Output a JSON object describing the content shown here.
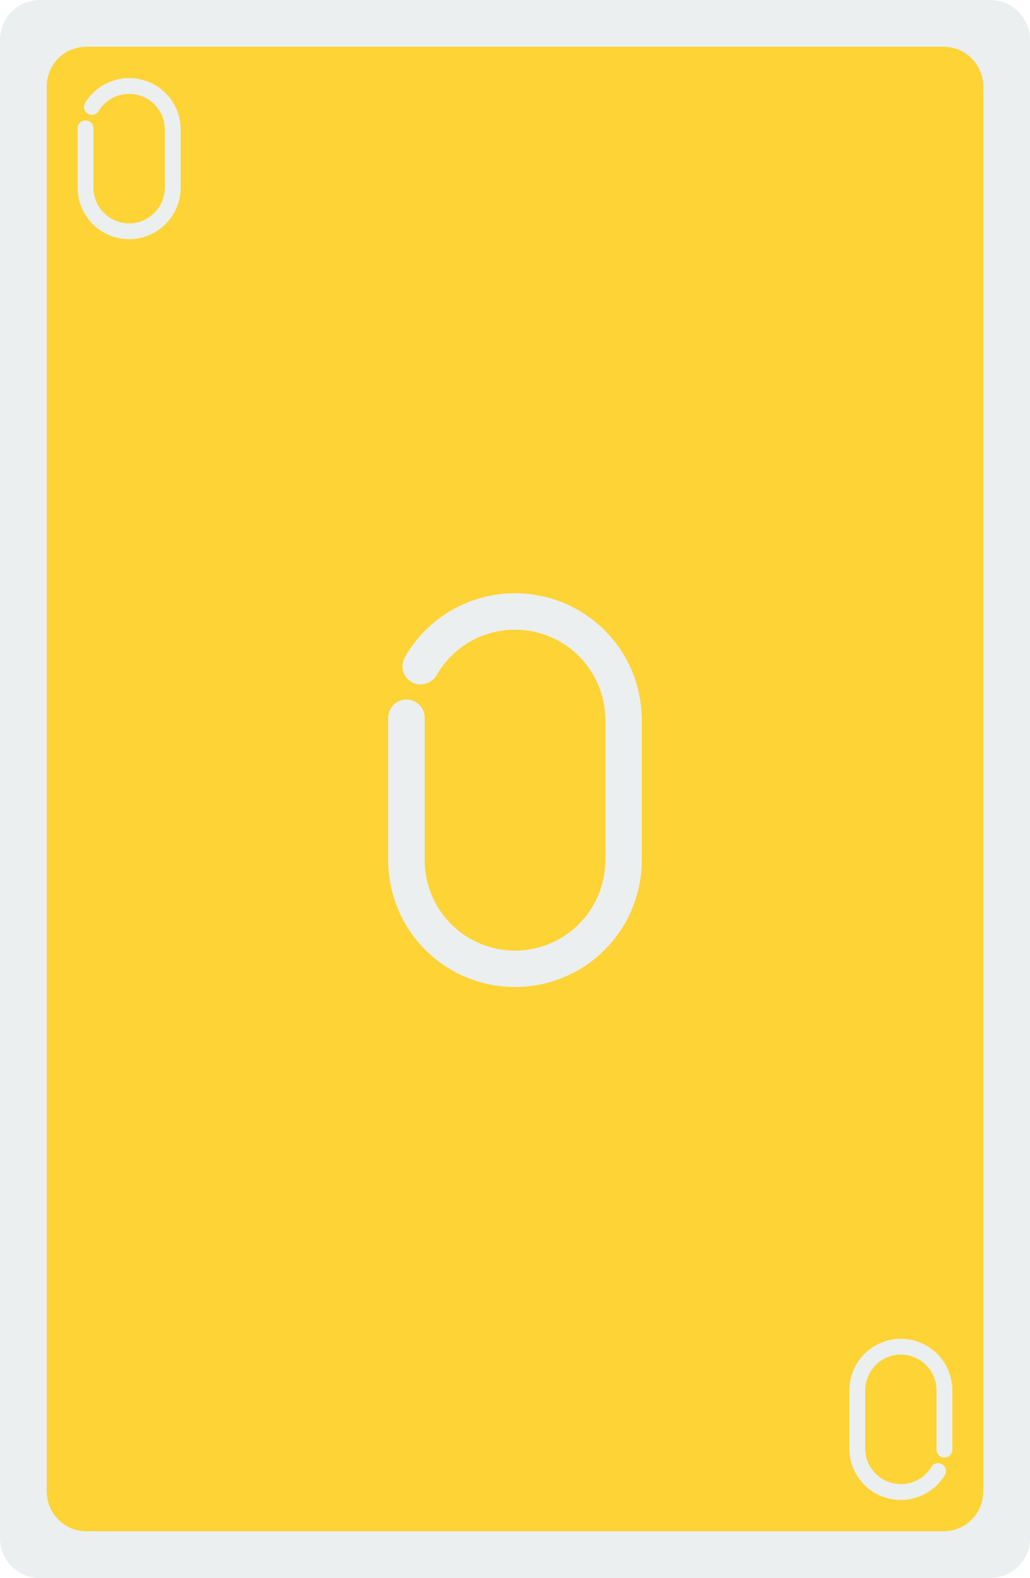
{
  "card": {
    "value": "0",
    "colors": {
      "border": "#ECEFF0",
      "face": "#FDD335",
      "symbol": "#ECEFF0"
    },
    "icons": {
      "corner_top_left": "zero-digit-icon",
      "center": "zero-digit-icon",
      "corner_bottom_right": "zero-digit-icon"
    }
  }
}
